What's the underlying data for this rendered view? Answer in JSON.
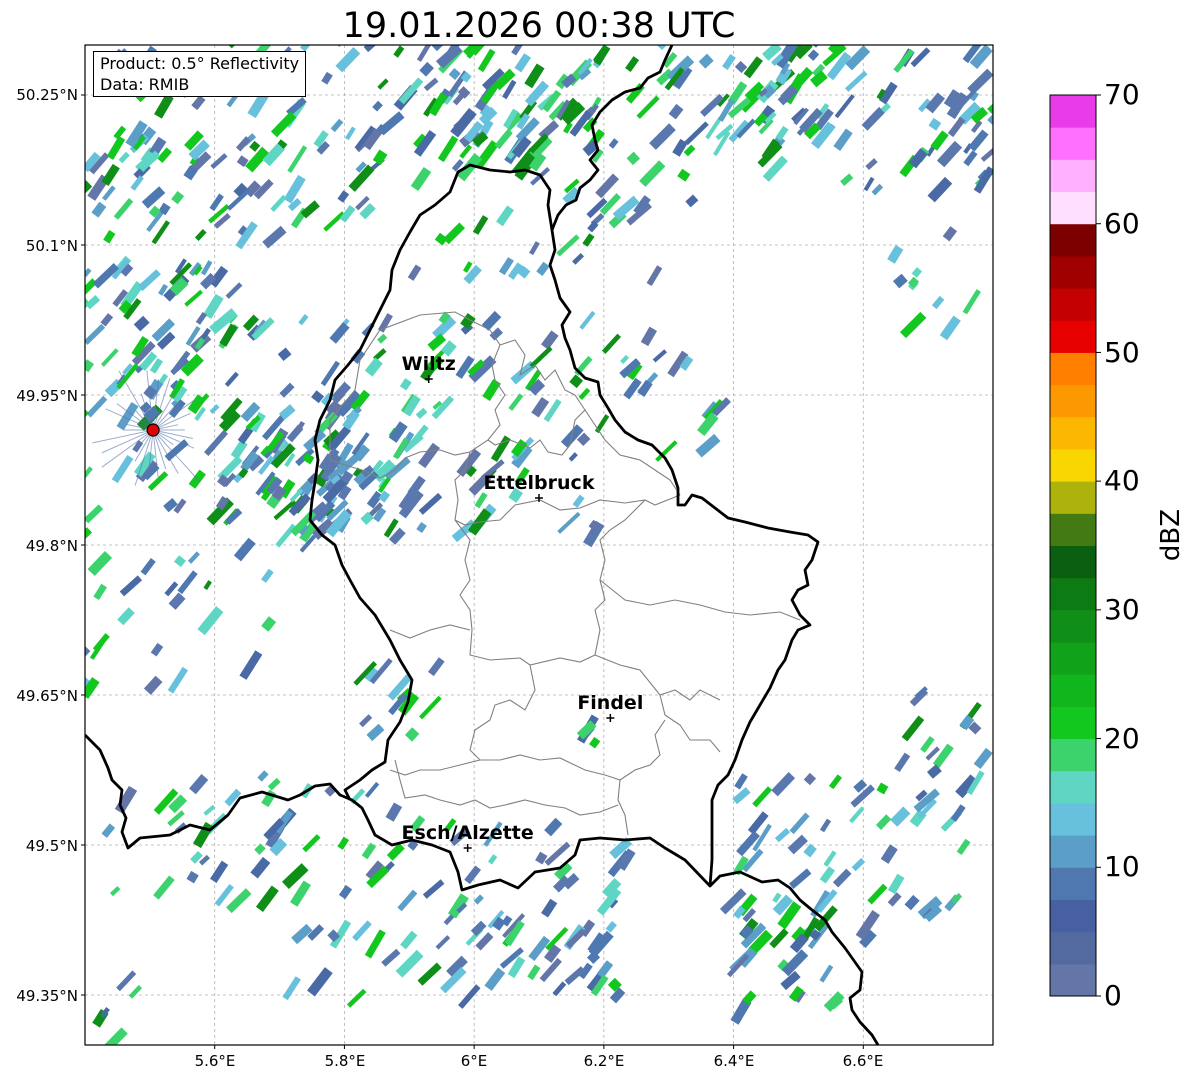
{
  "title": "19.01.2026 00:38 UTC",
  "info_box": {
    "product": "Product: 0.5° Reflectivity",
    "data": "Data: RMIB"
  },
  "lat_ticks": [
    "50.25°N",
    "50.1°N",
    "49.95°N",
    "49.8°N",
    "49.65°N",
    "49.5°N",
    "49.35°N"
  ],
  "lon_ticks": [
    "5.6°E",
    "5.8°E",
    "6°E",
    "6.2°E",
    "6.4°E",
    "6.6°E"
  ],
  "cities": [
    {
      "name": "Wiltz",
      "lon": 5.93,
      "lat": 49.966
    },
    {
      "name": "Ettelbruck",
      "lon": 6.1,
      "lat": 49.847
    },
    {
      "name": "Findel",
      "lon": 6.21,
      "lat": 49.627
    },
    {
      "name": "Esch/Alzette",
      "lon": 5.99,
      "lat": 49.497
    }
  ],
  "radar_site": {
    "lon": 5.505,
    "lat": 49.915
  },
  "colorbar": {
    "label": "dBZ",
    "ticks": [
      "0",
      "10",
      "20",
      "30",
      "40",
      "50",
      "60",
      "70"
    ],
    "colors": [
      "#6475a8",
      "#526aa0",
      "#4660a2",
      "#4f78b0",
      "#5b9ec8",
      "#67c0dc",
      "#5fd6c4",
      "#3dd36c",
      "#12c71e",
      "#11b51c",
      "#10a31a",
      "#0f8f17",
      "#0d7b14",
      "#0a6010",
      "#437a12",
      "#adb30b",
      "#f9d600",
      "#fcb800",
      "#fc9800",
      "#ff7f00",
      "#e60000",
      "#c40000",
      "#a00000",
      "#7d0000",
      "#ffdfff",
      "#ffb0ff",
      "#ff70ff",
      "#e83ce8"
    ]
  },
  "map_extent": {
    "lon_min": 5.4,
    "lon_max": 6.8,
    "lat_min": 49.3,
    "lat_max": 50.3
  }
}
